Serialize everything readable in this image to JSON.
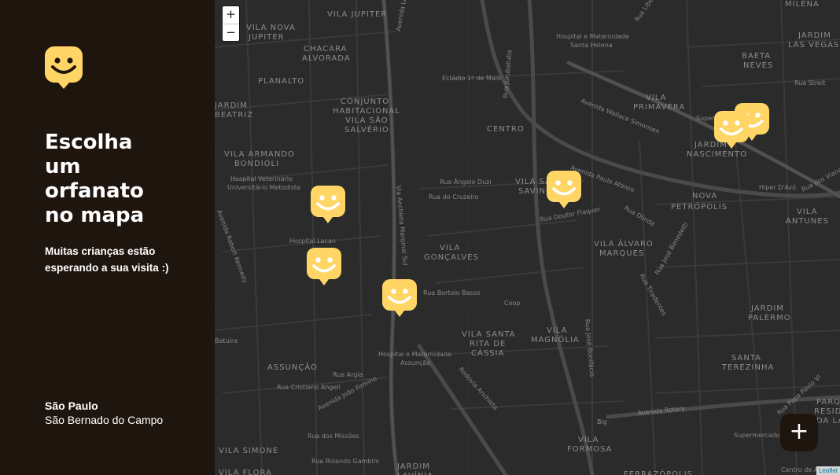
{
  "sidebar": {
    "headline": "Escolha\num\norfanato\nno mapa",
    "subtitle": "Muitas crianças estão esperando a sua visita :)",
    "location": {
      "city": "São Paulo",
      "district": "São Bernado do Campo"
    }
  },
  "map": {
    "zoom_in": "+",
    "zoom_out": "−",
    "attribution": "Leaflet",
    "add_button": "+",
    "marker_icon": "smiley-marker-icon",
    "marker_color": "#ffd666",
    "area_labels": [
      "VILA\nJUPITER",
      "VILA NOVA\nJUPITER",
      "CHACARA\nALVORADA",
      "PLANALTO",
      "JARDIM\nBEATRIZ",
      "CONJUNTO\nHABITACIONAL\nVILA SÃO\nSALVÉRIO",
      "VILA ARMANDO\nBONDIOLI",
      "CENTRO",
      "VILA\nPRIMAVERA",
      "JARDIM\nNASCIMENTO",
      "JARDIM\nLAS VEGAS",
      "BAETA\nNEVES",
      "MILENA",
      "VILA SÃO\nSAVINO",
      "NOVA\nPETRÓPOLIS",
      "VILA\nANTUNES",
      "VILA\nGONÇALVES",
      "VILA ÁLVARO\nMARQUES",
      "VILA SANTA\nRITA DE\nCÁSSIA",
      "VILA\nMAGNÓLIA",
      "JARDIM\nPALERMO",
      "SANTA\nTEREZINHA",
      "ASSUNÇÃO",
      "VILA\nFORMOSA",
      "VILA SIMONE",
      "JARDIM\nLAVÍNIA",
      "VILA FLORA",
      "FERRAZÓPOLIS",
      "PARQUE\nRESIDENCIAL\nDA LAPA"
    ],
    "street_labels": [
      "Avenida Lions",
      "Rua Jurubatuba",
      "Hospital e Maternidade\nSanta Helena",
      "Estádio 1º de Maio",
      "Rua Liberdade",
      "Avenida Wallace Simonsen",
      "Supermercado",
      "Rua Streit",
      "Hiper D'Avó",
      "Rua dos Vianas",
      "Hospital Veterinário\nUniversitário Metodista",
      "Rua Ângelo Duzi",
      "Rua do Cruzeiro",
      "Via Anchieta Marginal Sul",
      "Avenida Paulo Afonso",
      "Rua Doutor Flaquer",
      "Rua Olinda",
      "Rua José Benedetti",
      "Rua Tiradentes",
      "Avenida Robert Kennedy",
      "Hospital Lacan",
      "Rua Bortolo Basso",
      "Coop",
      "Rua José Bonifácio",
      "Batuíra",
      "Hospital e Maternidade\nAssunção",
      "Rua Argia",
      "Rua Cristiano Angeli",
      "Avenida João Firmino",
      "Rodovia Anchieta",
      "Avenida Rotary",
      "Big",
      "Supermercado",
      "Rua Papa Paulo VI",
      "Rua dos Missões",
      "Rua Rolando Gambini",
      "Centro de A"
    ]
  }
}
